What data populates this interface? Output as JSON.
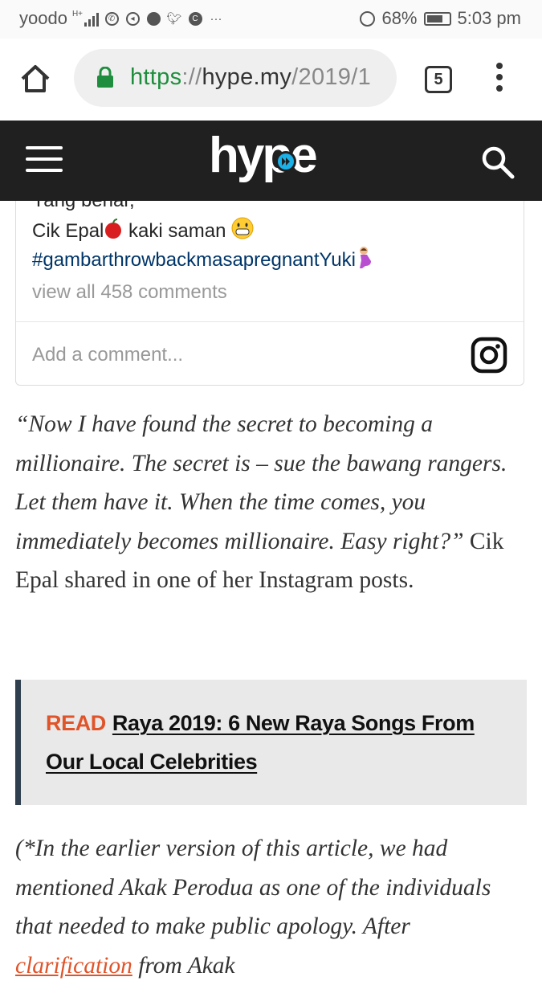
{
  "status_bar": {
    "carrier": "yoodo",
    "signal_label": "H+",
    "battery": "68%",
    "time": "5:03 pm"
  },
  "browser": {
    "url_scheme": "https",
    "url_sep": "://",
    "url_host": "hype.my",
    "url_path": "/2019/1",
    "tab_count": "5"
  },
  "site": {
    "logo_text": "hype"
  },
  "instagram": {
    "partial_line": "Yang benar,",
    "signature_text": "Cik Epal",
    "signature_suffix": " kaki saman ",
    "hashtag": "#gambarthrowbackmasapregnantYuki",
    "view_all": "view all 458 comments",
    "add_comment_placeholder": "Add a comment..."
  },
  "article": {
    "quote": "“Now I have found the secret to becoming a millionaire. The secret is – sue the bawang rangers. Let them have it. When the time comes, you immediately becomes millionaire. Easy right?”",
    "quote_lead": " ",
    "after_quote": " Cik Epal shared in one of her Instagram posts.",
    "read_label": "READ",
    "read_link": "Raya 2019: 6 New Raya Songs From Our Local Celebrities",
    "note_italic": "(*In the earlier version of this article, we had mentioned Akak Perodua as one of the individuals that needed to make public apology. After ",
    "note_link": "clarification",
    "note_tail": " from Akak"
  },
  "colors": {
    "header_bg": "#202020",
    "read_accent": "#e0542a",
    "read_border": "#2f3f4e",
    "hashtag": "#003569",
    "url_green": "#1e8e3e"
  }
}
